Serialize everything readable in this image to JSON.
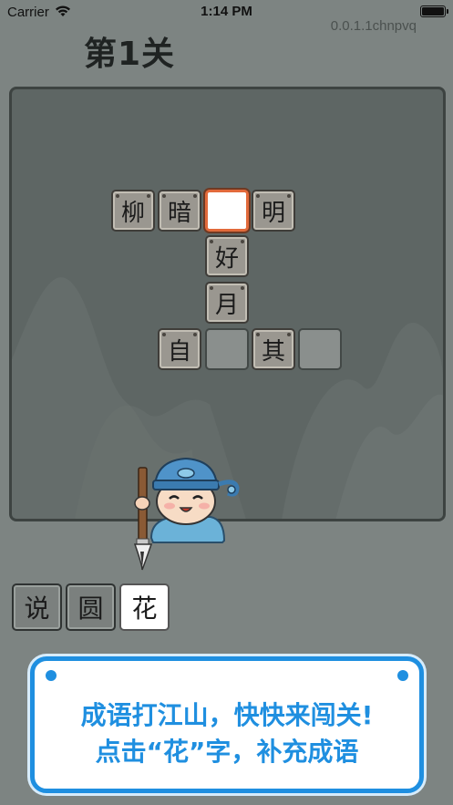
{
  "status_bar": {
    "carrier": "Carrier",
    "time": "1:14 PM"
  },
  "version": "0.0.1.1chnpvq",
  "level_title": "第1关",
  "board": {
    "row1": [
      "柳",
      "暗",
      "",
      "明"
    ],
    "col": [
      "好",
      "月"
    ],
    "row4": [
      "自",
      "",
      "其",
      ""
    ]
  },
  "choices": [
    "说",
    "圆",
    "花"
  ],
  "tip": {
    "line1": "成语打江山，快快来闯关!",
    "line2": "点击“花”字，补充成语"
  },
  "colors": {
    "accent": "#1f8fe0",
    "selected_border": "#e26a3b"
  }
}
